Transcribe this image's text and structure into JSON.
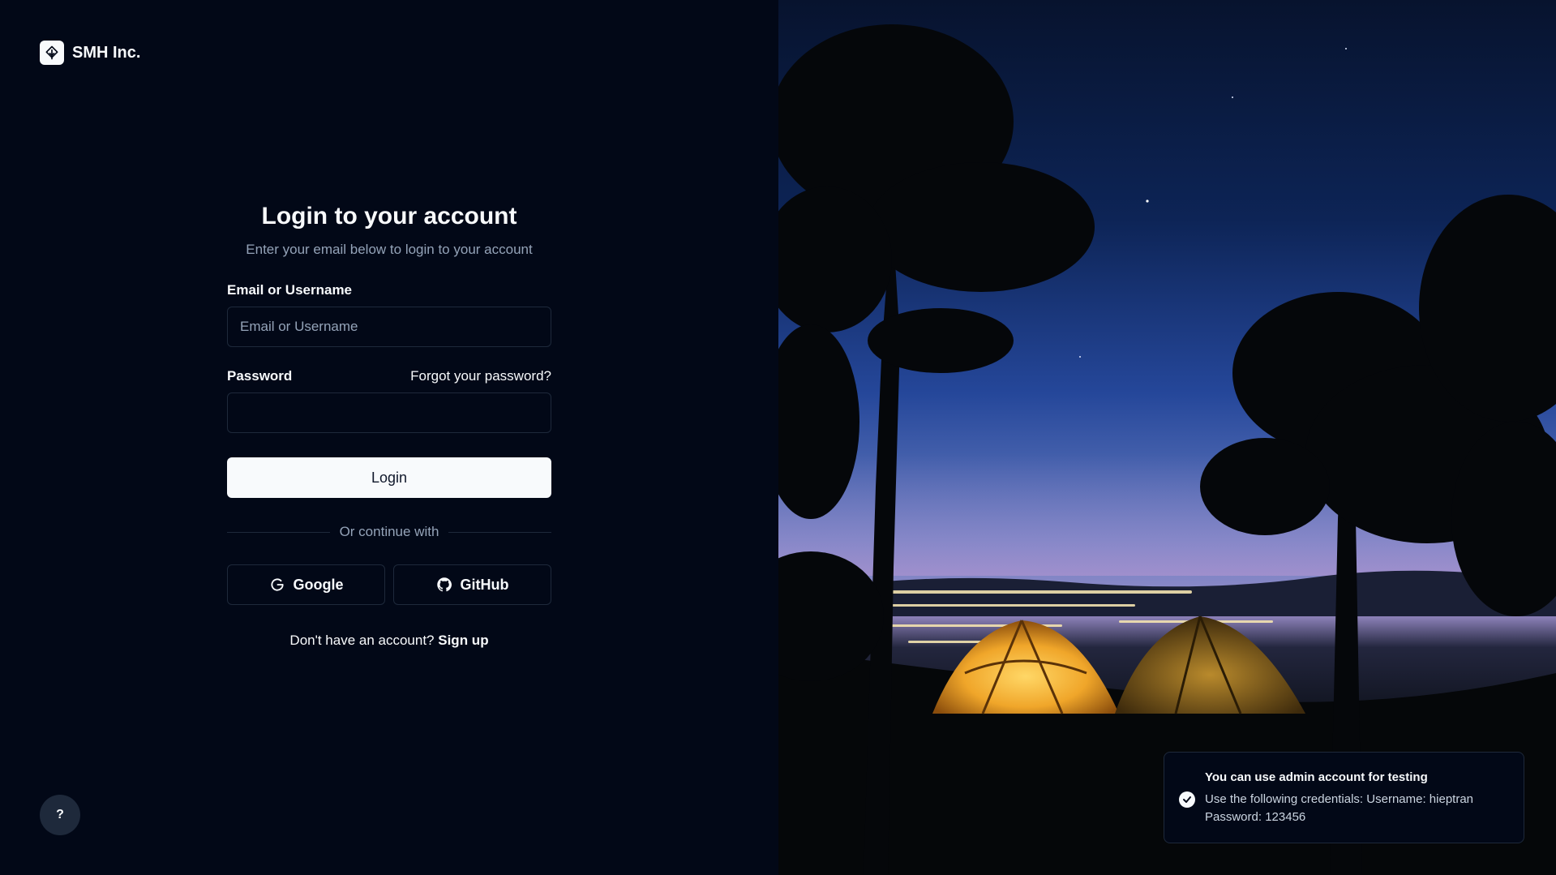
{
  "brand": {
    "name": "SMH Inc.",
    "icon": "leaf-logo-icon"
  },
  "login": {
    "title": "Login to your account",
    "subtitle": "Enter your email below to login to your account",
    "email_label": "Email or Username",
    "email_placeholder": "Email or Username",
    "email_value": "",
    "password_label": "Password",
    "forgot_link": "Forgot your password?",
    "password_value": "",
    "login_button": "Login",
    "divider_text": "Or continue with",
    "google_button": "Google",
    "github_button": "GitHub",
    "signup_prompt": "Don't have an account?",
    "signup_link": "Sign up"
  },
  "help": {
    "label": "?"
  },
  "toast": {
    "title": "You can use admin account for testing",
    "description": "Use the following credentials: Username: hieptran Password: 123456"
  },
  "colors": {
    "background": "#020817",
    "foreground": "#f8fafc",
    "muted": "#94a3b8",
    "border": "#1e293b",
    "tent_glow": "#f0a62a"
  }
}
